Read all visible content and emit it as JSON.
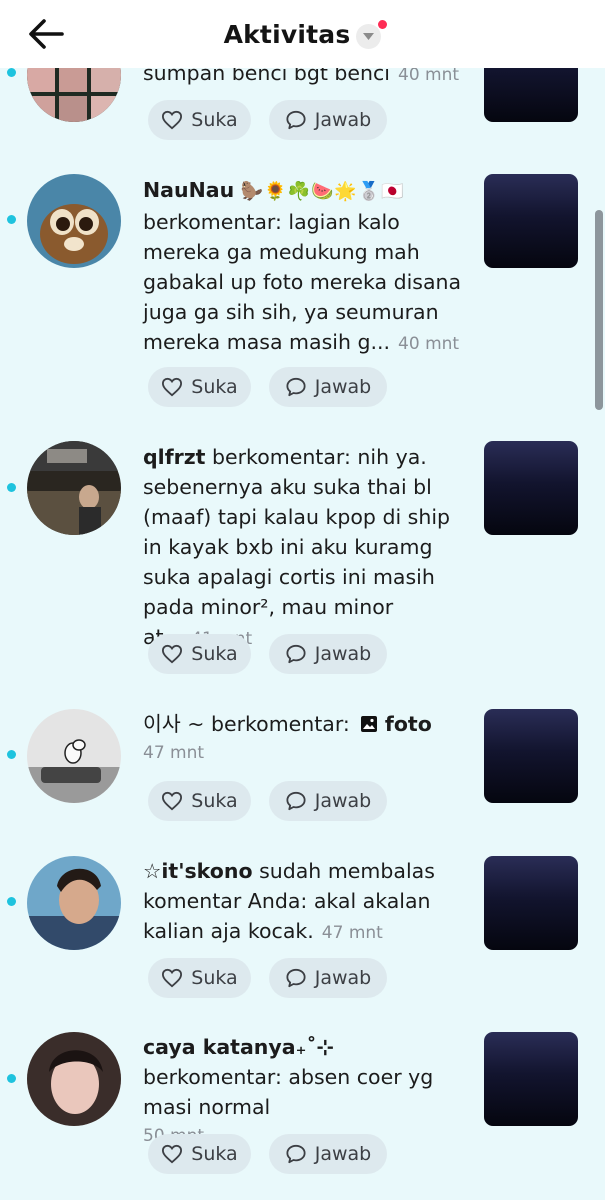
{
  "header": {
    "title": "Aktivitas"
  },
  "buttons": {
    "like": "Suka",
    "reply": "Jawab"
  },
  "items": [
    {
      "tail": "sumpan benci bgt benci",
      "time": "40 mnt"
    },
    {
      "user": "NauNau",
      "user_emoji": "🦫🌻☘️🍉🌟🥈🇯🇵",
      "action": "berkomentar: lagian kalo mereka ga medukung mah gabakal up foto mereka disana juga ga sih sih, ya seumuran mereka masa masih g...",
      "time": "40 mnt"
    },
    {
      "user": "qlfrzt",
      "action": "berkomentar: nih ya. sebenernya aku suka thai bl (maaf) tapi kalau kpop di ship in kayak bxb ini aku kuramg suka apalagi cortis ini masih pada minor², mau minor at...",
      "time": "41 mnt"
    },
    {
      "user": "이사 ~",
      "action": "berkomentar:",
      "attachment": "foto",
      "time": "47 mnt"
    },
    {
      "user": "☆it'skono",
      "action": "sudah membalas komentar Anda: akal akalan kalian aja kocak.",
      "time": "47 mnt"
    },
    {
      "user": "caya katanya₊˚⊹",
      "action": "berkomentar: absen coer yg masi normal",
      "time": "50 mnt"
    }
  ],
  "colors": {
    "background": "#e9f9fb",
    "unread_dot": "#1ec3de",
    "header_badge": "#fe2c55",
    "button_bg": "#dde9ee"
  },
  "icons": [
    "back-arrow-icon",
    "chevron-down-icon",
    "heart-icon",
    "speech-bubble-icon",
    "image-icon"
  ]
}
